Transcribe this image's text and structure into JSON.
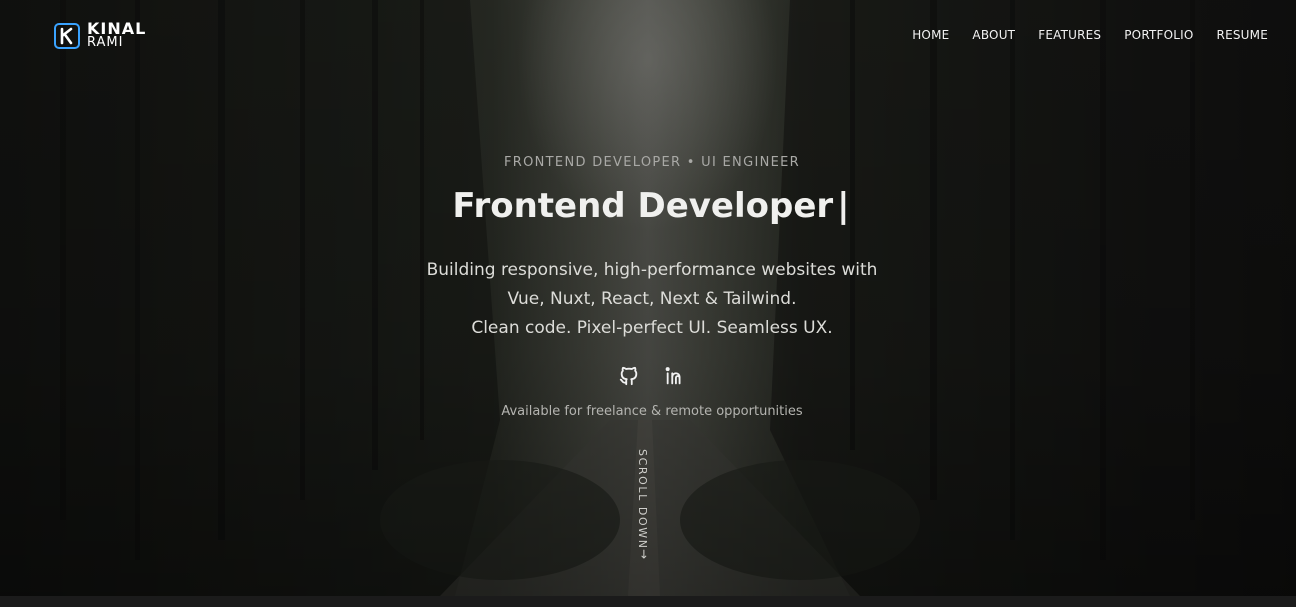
{
  "brand": {
    "first_name": "KINAL",
    "last_name": "RAMI",
    "accent": "#3aa3ff"
  },
  "nav": {
    "items": [
      "HOME",
      "ABOUT",
      "FEATURES",
      "PORTFOLIO",
      "RESUME"
    ]
  },
  "hero": {
    "eyebrow": "FRONTEND DEVELOPER • UI ENGINEER",
    "headline": "Frontend Developer",
    "cursor": "|",
    "tagline": [
      "Building responsive, high-performance websites with",
      "Vue, Nuxt, React, Next & Tailwind.",
      "Clean code. Pixel-perfect UI. Seamless UX."
    ],
    "social_icons": [
      "github-icon",
      "linkedin-icon"
    ],
    "availability": "Available for freelance & remote opportunities",
    "scroll_label": "SCROLL DOWN",
    "scroll_arrow": "→"
  }
}
